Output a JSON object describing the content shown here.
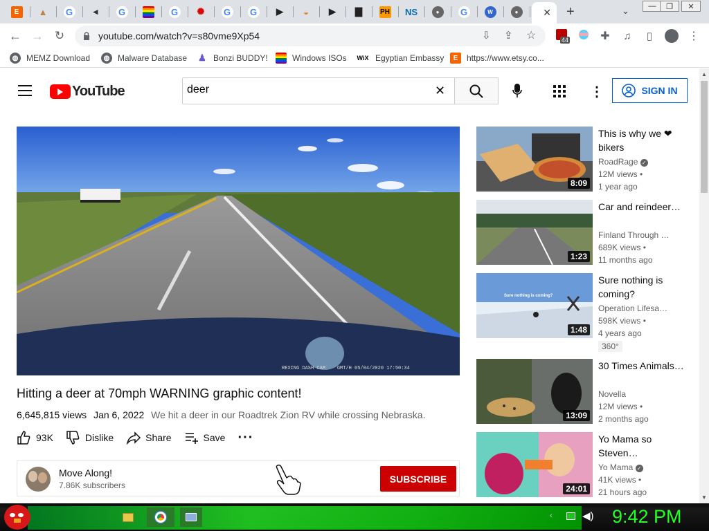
{
  "browser": {
    "url": "youtube.com/watch?v=s80vme9Xp54",
    "tabs": [
      {
        "icon": "etsy-icon",
        "glyph": "E",
        "color": "#f56400"
      },
      {
        "icon": "person-icon",
        "glyph": "▲",
        "color": "#c0804a"
      },
      {
        "icon": "google-icon",
        "glyph": "G",
        "color": "#4285f4"
      },
      {
        "icon": "speaker-icon",
        "glyph": "◂",
        "color": "#333"
      },
      {
        "icon": "google-icon",
        "glyph": "G",
        "color": "#4285f4"
      },
      {
        "icon": "rainbow-flag-icon",
        "glyph": "",
        "color": "#e40303"
      },
      {
        "icon": "google-icon",
        "glyph": "G",
        "color": "#4285f4"
      },
      {
        "icon": "cbc-icon",
        "glyph": "✺",
        "color": "#d00"
      },
      {
        "icon": "google-icon",
        "glyph": "G",
        "color": "#4285f4"
      },
      {
        "icon": "google-icon",
        "glyph": "G",
        "color": "#4285f4"
      },
      {
        "icon": "cursor-icon",
        "glyph": "▶",
        "color": "#222"
      },
      {
        "icon": "paint-icon",
        "glyph": "◒",
        "color": "#e08030"
      },
      {
        "icon": "cursor-icon",
        "glyph": "▶",
        "color": "#222"
      },
      {
        "icon": "bus-icon",
        "glyph": "▇",
        "color": "#222"
      },
      {
        "icon": "pornhub-icon",
        "glyph": "PH",
        "color": "#f90"
      },
      {
        "icon": "ns-icon",
        "glyph": "NS",
        "color": "#0a6ab0"
      },
      {
        "icon": "globe-icon",
        "glyph": "●",
        "color": "#666"
      },
      {
        "icon": "google-icon",
        "glyph": "G",
        "color": "#4285f4"
      },
      {
        "icon": "wikipedia-icon",
        "glyph": "W",
        "color": "#3366cc"
      },
      {
        "icon": "globe-icon",
        "glyph": "●",
        "color": "#666"
      }
    ],
    "bookmarks": [
      {
        "label": "MEMZ Download",
        "icon": "globe-icon"
      },
      {
        "label": "Malware Database",
        "icon": "globe-icon"
      },
      {
        "label": "Bonzi BUDDY!",
        "icon": "bonzi-icon"
      },
      {
        "label": "Windows ISOs",
        "icon": "rainbow-flag-icon"
      },
      {
        "label": "Egyptian Embassy",
        "icon": "wix-icon",
        "glyph": "WiX"
      },
      {
        "label": "https://www.etsy.co...",
        "icon": "etsy-icon",
        "glyph": "E"
      }
    ],
    "extension_badge": "44"
  },
  "youtube": {
    "search_value": "deer",
    "logo_text": "YouTube",
    "sign_in": "SIGN IN",
    "video": {
      "title": "Hitting a deer at 70mph WARNING graphic content!",
      "views": "6,645,815 views",
      "date": "Jan 6, 2022",
      "description": "We hit a deer in our Roadtrek Zion RV while crossing Nebraska.",
      "overlay_text": "REXING DASH CAM    GMT/H 05/04/2020 17:50:34",
      "likes": "93K",
      "dislike": "Dislike",
      "share": "Share",
      "save": "Save"
    },
    "channel": {
      "name": "Move Along!",
      "subscribers": "7.86K subscribers",
      "subscribe": "SUBSCRIBE"
    },
    "recommendations": [
      {
        "title": "This is why we ❤ bikers",
        "channel": "RoadRage",
        "verified": true,
        "views": "12M views",
        "age": "1 year ago",
        "duration": "8:09",
        "thumb": "pizza"
      },
      {
        "title": "Car and reindeer…",
        "channel": "Finland Through …",
        "verified": false,
        "views": "689K views",
        "age": "11 months ago",
        "duration": "1:23",
        "thumb": "road"
      },
      {
        "title": "Sure nothing is coming?",
        "channel": "Operation Lifesa…",
        "verified": false,
        "views": "598K views",
        "age": "4 years ago",
        "duration": "1:48",
        "thumb": "snow",
        "badge": "360°",
        "overlay": "Sure nothing is coming?"
      },
      {
        "title": "30 Times Animals…",
        "channel": "Novella",
        "verified": false,
        "views": "12M views",
        "age": "2 months ago",
        "duration": "13:09",
        "thumb": "gorilla"
      },
      {
        "title": "Yo Mama so Steven…",
        "channel": "Yo Mama",
        "verified": true,
        "views": "41K views",
        "age": "21 hours ago",
        "duration": "24:01",
        "thumb": "cartoon"
      }
    ]
  },
  "taskbar": {
    "clock": "9:42 PM"
  }
}
